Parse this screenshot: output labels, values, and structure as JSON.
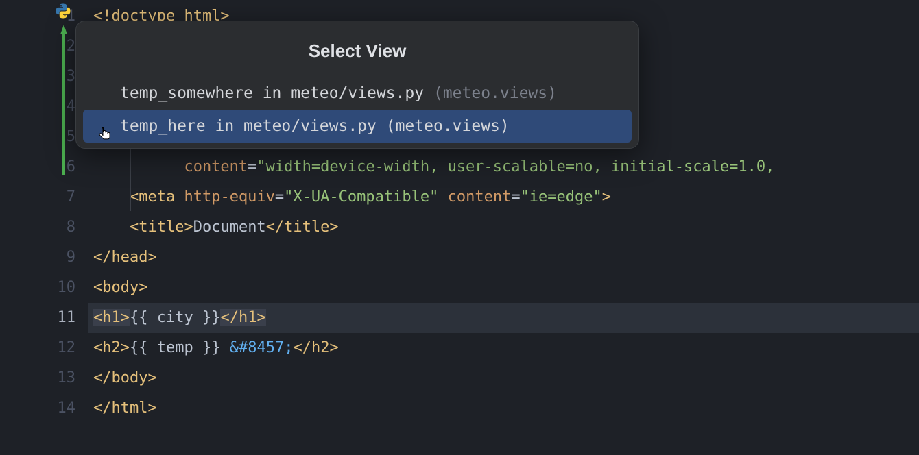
{
  "gutter": {
    "start": 1,
    "end": 14,
    "highlighted_line": 11
  },
  "popup": {
    "title": "Select View",
    "items": [
      {
        "label": "temp_somewhere in meteo/views.py",
        "hint": " (meteo.views)",
        "selected": false
      },
      {
        "label": "temp_here in meteo/views.py (meteo.views)",
        "hint": "",
        "selected": true
      }
    ]
  },
  "code": {
    "l1": "<!doctype html>",
    "l6_indent": "          ",
    "l6_attr": "content",
    "l6_eq": "=",
    "l6_str": "\"width=device-width, user-scalable=no, initial-scale=1.0,",
    "l7_indent": "    ",
    "l7_open": "<",
    "l7_tag": "meta",
    "l7_sp": " ",
    "l7_attr1": "http-equiv",
    "l7_eq1": "=",
    "l7_str1": "\"X-UA-Compatible\"",
    "l7_sp2": " ",
    "l7_attr2": "content",
    "l7_eq2": "=",
    "l7_str2": "\"ie=edge\"",
    "l7_close": ">",
    "l8_indent": "    ",
    "l8_open": "<",
    "l8_tag": "title",
    "l8_gt": ">",
    "l8_text": "Document",
    "l8_close_open": "</",
    "l8_close_tag": "title",
    "l8_close_gt": ">",
    "l9_open": "</",
    "l9_tag": "head",
    "l9_close": ">",
    "l10_open": "<",
    "l10_tag": "body",
    "l10_close": ">",
    "l11_open": "<",
    "l11_tag": "h1",
    "l11_gt": ">",
    "l11_var_open": "{{ ",
    "l11_var": "city",
    "l11_var_close": " }}",
    "l11_close_open": "</",
    "l11_close_tag": "h1",
    "l11_close_gt": ">",
    "l12_open": "<",
    "l12_tag": "h2",
    "l12_gt": ">",
    "l12_var_open": "{{ ",
    "l12_var": "temp",
    "l12_var_close": " }}",
    "l12_sp": " ",
    "l12_entity": "&#8457;",
    "l12_close_open": "</",
    "l12_close_tag": "h2",
    "l12_close_gt": ">",
    "l13_open": "</",
    "l13_tag": "body",
    "l13_close": ">",
    "l14_open": "</",
    "l14_tag": "html",
    "l14_close": ">"
  }
}
